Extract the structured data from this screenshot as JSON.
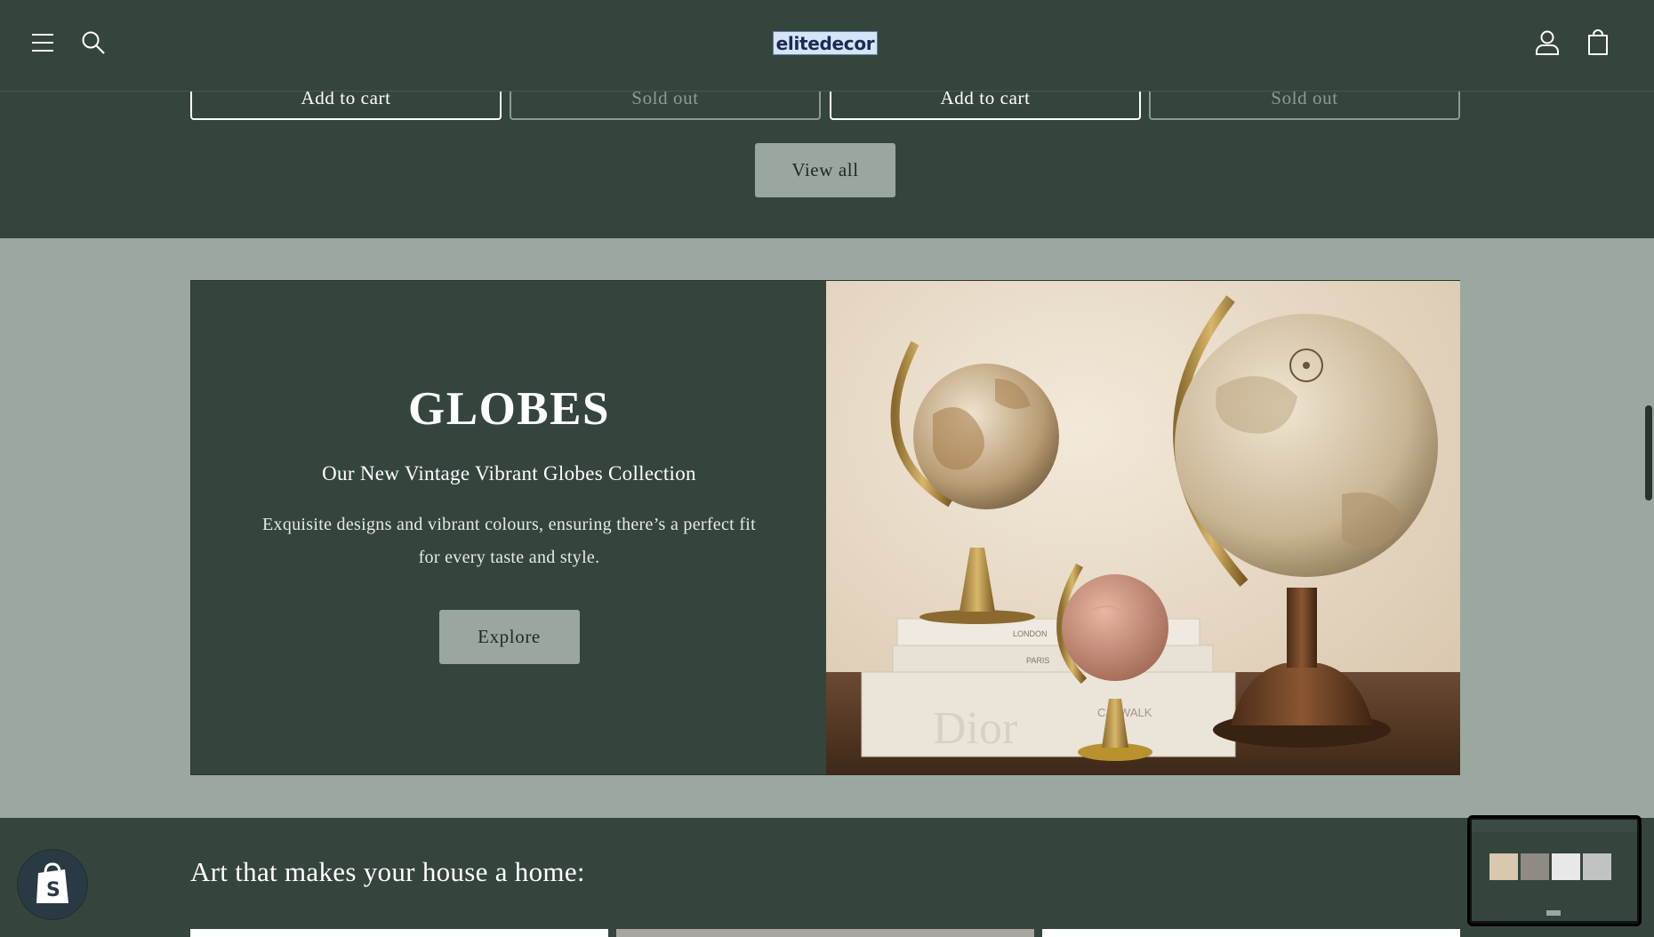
{
  "header": {
    "logo_text": "elitedecor",
    "icons": [
      "menu-icon",
      "search-icon",
      "account-icon",
      "cart-icon"
    ]
  },
  "products": {
    "buttons": [
      "Add to cart",
      "Sold out",
      "Add to cart",
      "Sold out"
    ]
  },
  "view_all_label": "View all",
  "banner": {
    "title": "GLOBES",
    "subtitle": "Our New Vintage Vibrant Globes Collection",
    "description": "Exquisite designs and vibrant colours, ensuring there’s a perfect fit for every taste and style.",
    "cta_label": "Explore",
    "image_book_text": "Dior",
    "image_book_spine_1": "LONDON",
    "image_book_spine_2": "PARIS",
    "image_book_spine_3": "CATWALK"
  },
  "art_section": {
    "title": "Art that makes your house a home:"
  },
  "colors": {
    "background": "#35453d",
    "section_light": "#9ba89f",
    "button": "#9aa7a0",
    "text": "#ffffff"
  }
}
